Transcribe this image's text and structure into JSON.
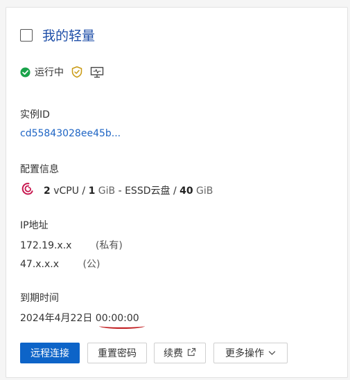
{
  "card": {
    "title": "我的轻量",
    "status": "运行中",
    "instance_id_label": "实例ID",
    "instance_id_value": "cd55843028ee45b...",
    "config_label": "配置信息",
    "config": {
      "cpu_num": "2",
      "cpu_unit": "vCPU",
      "sep1": "/",
      "mem_num": "1",
      "mem_unit": "GiB",
      "disk_type": "- ESSD云盘",
      "sep2": "/",
      "disk_num": "40",
      "disk_unit": "GiB"
    },
    "ip_label": "IP地址",
    "ip_private": "172.19.x.x",
    "ip_private_tag": "(私有)",
    "ip_public": "47.x.x.x",
    "ip_public_tag": "(公)",
    "expire_label": "到期时间",
    "expire_value": "2024年4月22日 00:00:00"
  },
  "buttons": {
    "remote": "远程连接",
    "reset_password": "重置密码",
    "renew": "续费",
    "more": "更多操作"
  },
  "colors": {
    "accent": "#0d64c8",
    "link": "#1d64c4",
    "status_ok": "#1aa34a",
    "shield": "#c99a13",
    "debian": "#c7154d",
    "highlight": "#c0181b"
  },
  "icons": {
    "status": "check-circle-icon",
    "security": "shield-check-icon",
    "monitor": "monitor-icon",
    "os": "debian-logo-icon",
    "external": "external-link-icon",
    "more": "chevron-down-icon"
  }
}
